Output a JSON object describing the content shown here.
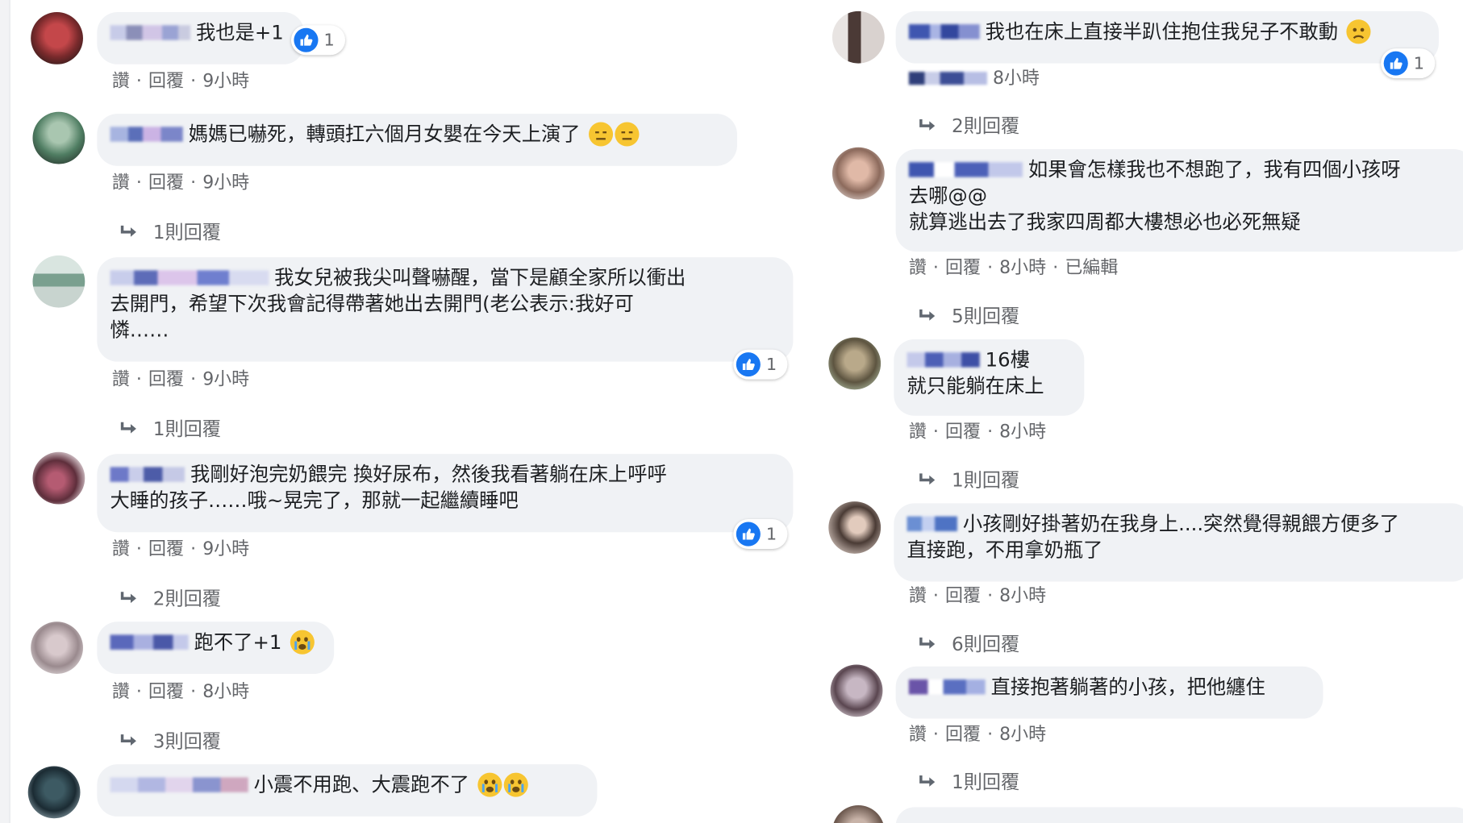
{
  "colors": {
    "bubble_bg": "#f0f2f5",
    "action_text": "#65676b",
    "like_blue": "#1877f2",
    "emoji_yellow": "#f7c531"
  },
  "actions": {
    "like": "讚",
    "reply": "回覆",
    "edited": "已編輯",
    "separator": "·"
  },
  "left_column": [
    {
      "id": "l1",
      "text": "我也是+1",
      "time": "9小時",
      "reaction_count": "1",
      "replies": ""
    },
    {
      "id": "l2",
      "text": "媽媽已嚇死，轉頭扛六個月女嬰在今天上演了",
      "emoji": [
        "expressionless-emoji",
        "expressionless-emoji"
      ],
      "time": "9小時",
      "replies": "1則回覆"
    },
    {
      "id": "l3",
      "text_lines": [
        "我女兒被我尖叫聲嚇醒，當下是顧全家所以衝出",
        "去開門，希望下次我會記得帶著她出去開門(老公表示:我好可",
        "憐……"
      ],
      "time": "9小時",
      "reaction_count": "1",
      "replies": "1則回覆"
    },
    {
      "id": "l4",
      "text_lines": [
        "我剛好泡完奶餵完 換好尿布，然後我看著躺在床上呼呼",
        "大睡的孩子……哦~晃完了，那就一起繼續睡吧"
      ],
      "time": "9小時",
      "reaction_count": "1",
      "replies": "2則回覆"
    },
    {
      "id": "l5",
      "text": "跑不了+1",
      "emoji": [
        "crying-emoji"
      ],
      "time": "8小時",
      "replies": "3則回覆"
    },
    {
      "id": "l6",
      "text": "小震不用跑、大震跑不了",
      "emoji": [
        "crying-emoji",
        "crying-emoji"
      ]
    }
  ],
  "right_column": [
    {
      "id": "r1",
      "text": "我也在床上直接半趴住抱住我兒子不敢動",
      "emoji": [
        "sad-emoji"
      ],
      "time": "8小時",
      "reaction_count": "1",
      "replies": "2則回覆"
    },
    {
      "id": "r2",
      "text_lines": [
        "如果會怎樣我也不想跑了，我有四個小孩呀",
        "去哪@@",
        "就算逃出去了我家四周都大樓想必也必死無疑"
      ],
      "time": "8小時",
      "edited": true,
      "replies": "5則回覆"
    },
    {
      "id": "r3",
      "text_lines": [
        "16樓",
        "就只能躺在床上"
      ],
      "time": "8小時",
      "replies": "1則回覆"
    },
    {
      "id": "r4",
      "text_lines": [
        "小孩剛好掛著奶在我身上....突然覺得親餵方便多了",
        "直接跑，不用拿奶瓶了"
      ],
      "time": "8小時",
      "replies": "6則回覆"
    },
    {
      "id": "r5",
      "text": "直接抱著躺著的小孩，把他纏住",
      "time": "8小時",
      "replies": "1則回覆"
    }
  ]
}
